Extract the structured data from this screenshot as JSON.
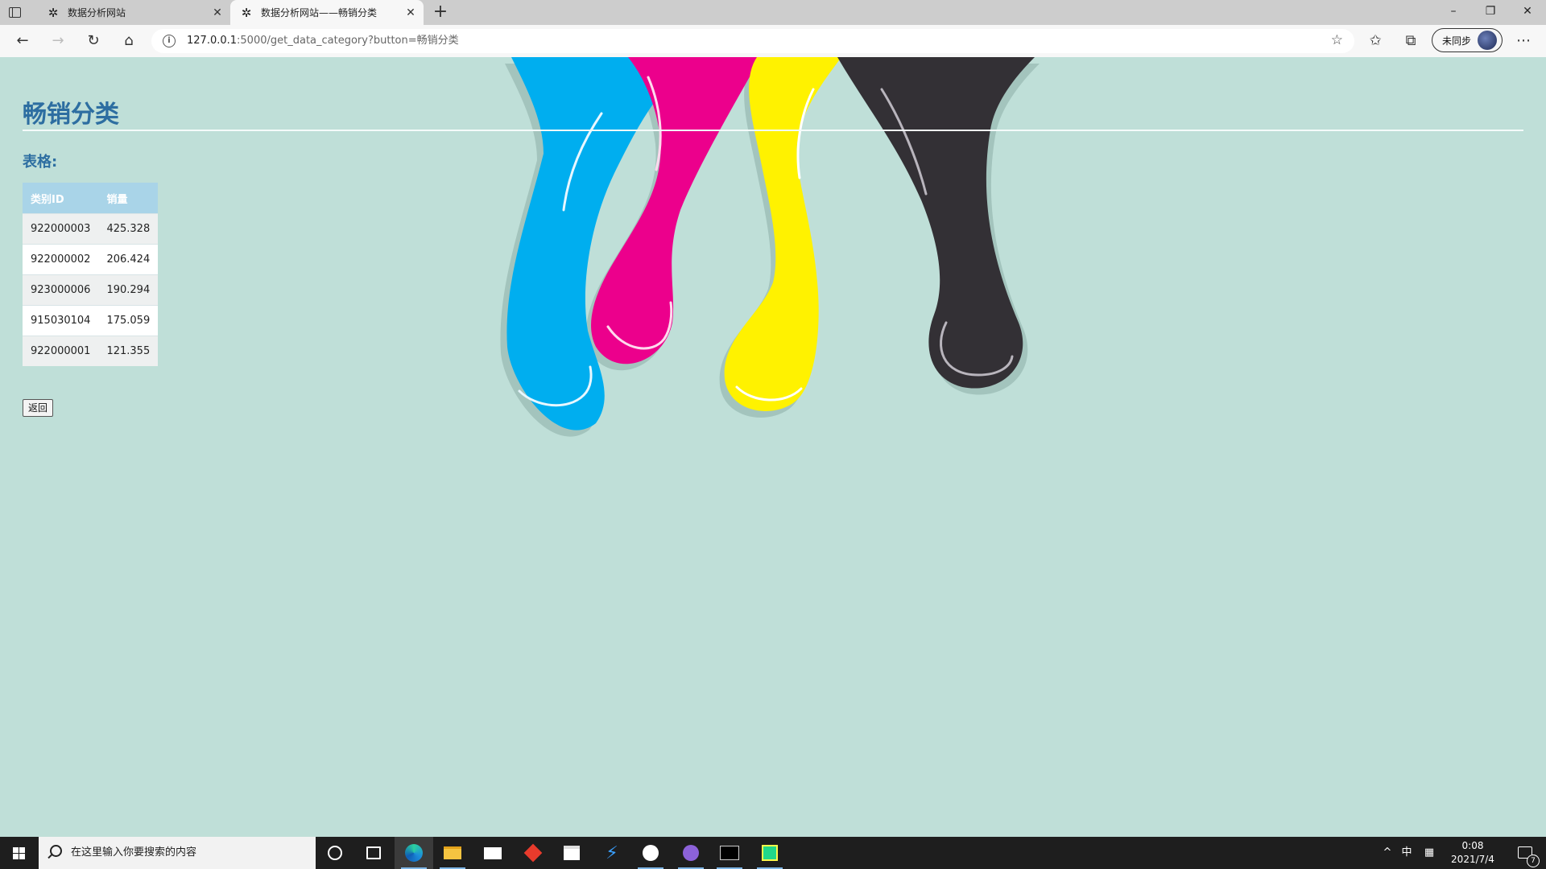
{
  "browser": {
    "tabs": [
      {
        "title": "数据分析网站",
        "active": false
      },
      {
        "title": "数据分析网站——畅销分类",
        "active": true
      }
    ],
    "address": {
      "host": "127.0.0.1",
      "path": ":5000/get_data_category?button=畅销分类"
    },
    "profile_label": "未同步"
  },
  "page": {
    "title": "畅销分类",
    "table_label": "表格:",
    "table": {
      "headers": [
        "类别ID",
        "销量"
      ],
      "rows": [
        [
          "922000003",
          "425.328"
        ],
        [
          "922000002",
          "206.424"
        ],
        [
          "923000006",
          "190.294"
        ],
        [
          "915030104",
          "175.059"
        ],
        [
          "922000001",
          "121.355"
        ]
      ]
    },
    "back_label": "返回",
    "colors": {
      "background": "#bfdfd8",
      "title": "#2d6ea1",
      "header": "#a9d4e8",
      "drip_cyan": "#00aeef",
      "drip_magenta": "#ec008c",
      "drip_yellow": "#fff200",
      "drip_black": "#333035"
    }
  },
  "taskbar": {
    "search_placeholder": "在这里输入你要搜索的内容",
    "ime": "中",
    "time": "0:08",
    "date": "2021/7/4",
    "notifications": "7"
  }
}
